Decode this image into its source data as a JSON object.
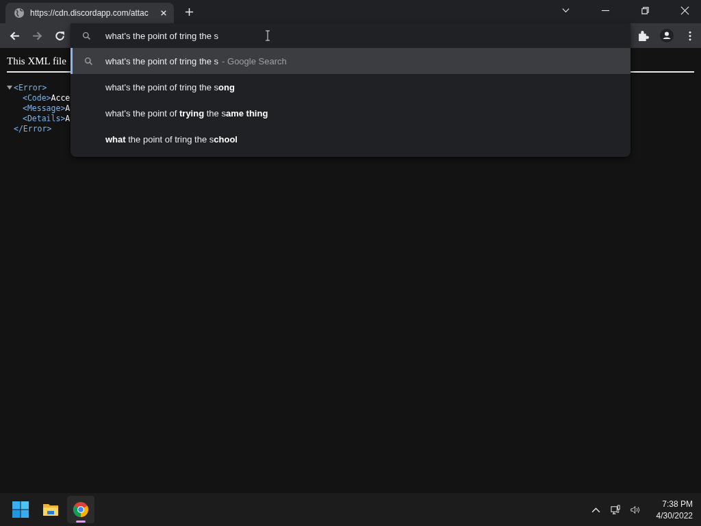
{
  "tab": {
    "title": "https://cdn.discordapp.com/attac",
    "selected": true
  },
  "omnibox": {
    "value": "what's the point of tring the s"
  },
  "suggestions": [
    {
      "kind": "search",
      "text": "what's the point of tring the s",
      "suffix": "- Google Search",
      "selected": true
    },
    {
      "kind": "plain",
      "text": "what's the point of tring the s**ong**",
      "selected": false
    },
    {
      "kind": "plain",
      "text": "what's the point of **trying** the s**ame thing**",
      "selected": false
    },
    {
      "kind": "plain",
      "text": "**what** the point of tring the s**chool**",
      "selected": false
    }
  ],
  "page": {
    "heading": "This XML file",
    "xml": [
      {
        "tag": "<Error>",
        "expanded": true,
        "children": [
          {
            "tag": "<Code>",
            "text": "Acce"
          },
          {
            "tag": "<Message>",
            "text": "A"
          },
          {
            "tag": "<Details>",
            "text": "A"
          }
        ]
      },
      {
        "tag": "</Error>"
      }
    ]
  },
  "taskbar": {
    "apps": [
      {
        "kind": "start",
        "selected": false
      },
      {
        "kind": "explorer",
        "selected": false
      },
      {
        "kind": "chrome",
        "selected": true
      }
    ],
    "time": "7:38 PM",
    "date": "4/30/2022"
  }
}
